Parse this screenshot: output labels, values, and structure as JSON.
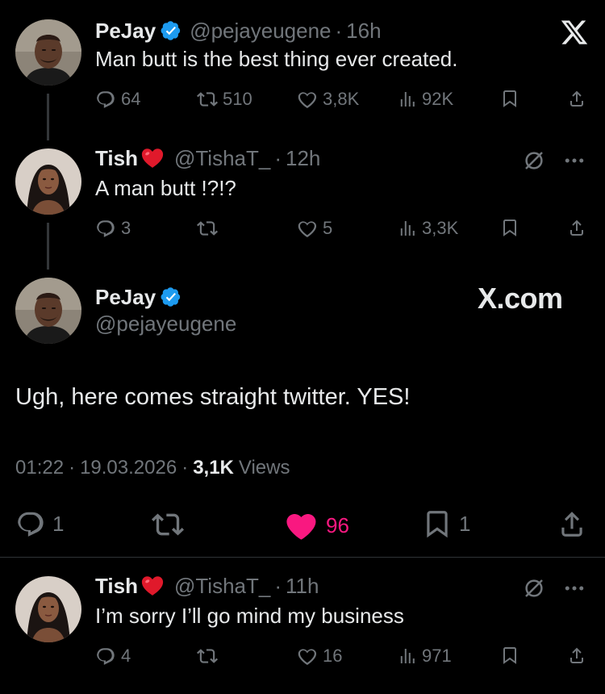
{
  "tweet1": {
    "name": "PeJay",
    "handle": "@pejayeugene",
    "time": "16h",
    "text": "Man butt is the best thing ever created.",
    "replies": "64",
    "reposts": "510",
    "likes": "3,8K",
    "views": "92K"
  },
  "tweet2": {
    "name": "Tish",
    "name_emoji": "❤️",
    "handle": "@TishaT_",
    "time": "12h",
    "text": "A man butt !?!?",
    "replies": "3",
    "reposts": "",
    "likes": "5",
    "views": "3,3K"
  },
  "main": {
    "name": "PeJay",
    "handle": "@pejayeugene",
    "watermark": "X.com",
    "text": "Ugh, here comes straight twitter. YES!",
    "time": "01:22",
    "date": "19.03.2026",
    "views_count": "3,1K",
    "views_label": "Views",
    "replies": "1",
    "likes": "96",
    "bookmarks": "1"
  },
  "reply": {
    "name": "Tish",
    "name_emoji": "❤️",
    "handle": "@TishaT_",
    "time": "11h",
    "text": "I’m sorry I’ll go mind my business",
    "replies": "4",
    "likes": "16",
    "views": "971"
  },
  "colors": {
    "background": "#000000",
    "text": "#e7e9ea",
    "muted": "#71767b",
    "verified": "#1d9bf0",
    "like": "#f91880"
  },
  "icons": [
    "x-logo-icon",
    "verified-badge-icon",
    "reply-icon",
    "repost-icon",
    "like-icon",
    "views-icon",
    "bookmark-icon",
    "share-icon",
    "grok-icon",
    "more-icon",
    "heart-emoji-icon"
  ]
}
